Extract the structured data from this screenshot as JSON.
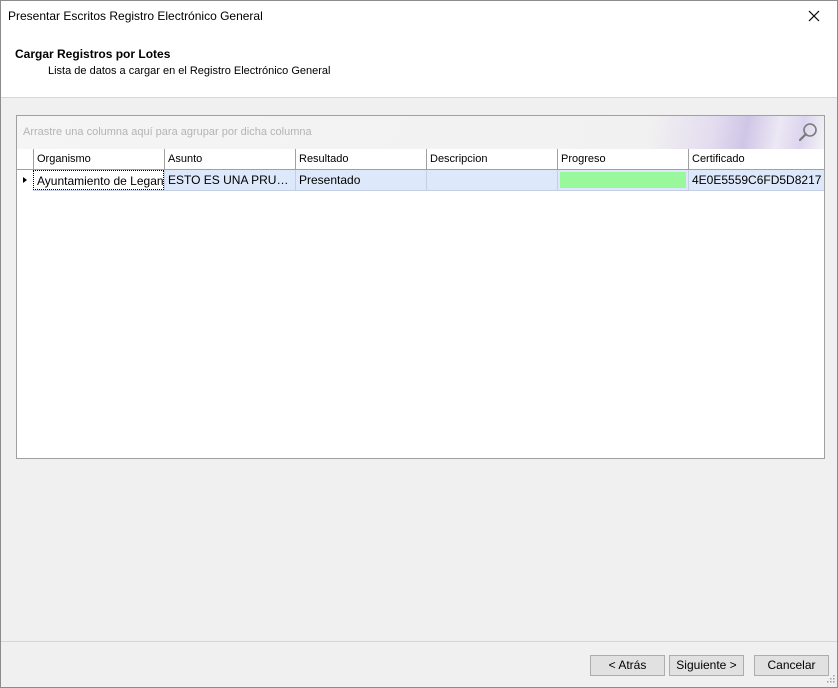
{
  "window": {
    "title": "Presentar Escritos Registro Electrónico General"
  },
  "header": {
    "title": "Cargar Registros por Lotes",
    "subtitle": "Lista de datos a cargar en el Registro Electrónico General"
  },
  "grid": {
    "group_panel_hint": "Arrastre una columna aquí para agrupar por dicha columna",
    "columns": [
      "Organismo",
      "Asunto",
      "Resultado",
      "Descripcion",
      "Progreso",
      "Certificado"
    ],
    "rows": [
      {
        "organismo": "Ayuntamiento de Leganés",
        "asunto": "ESTO ES UNA PRUEBA",
        "resultado": "Presentado",
        "descripcion": "",
        "progreso": 1.0,
        "certificado": "4E0E5559C6FD5D8217"
      }
    ]
  },
  "buttons": {
    "back": "< Atrás",
    "next": "Siguiente >",
    "cancel": "Cancelar"
  },
  "colors": {
    "progress_fill": "#99f79c",
    "selected_row": "#dde8fa"
  }
}
